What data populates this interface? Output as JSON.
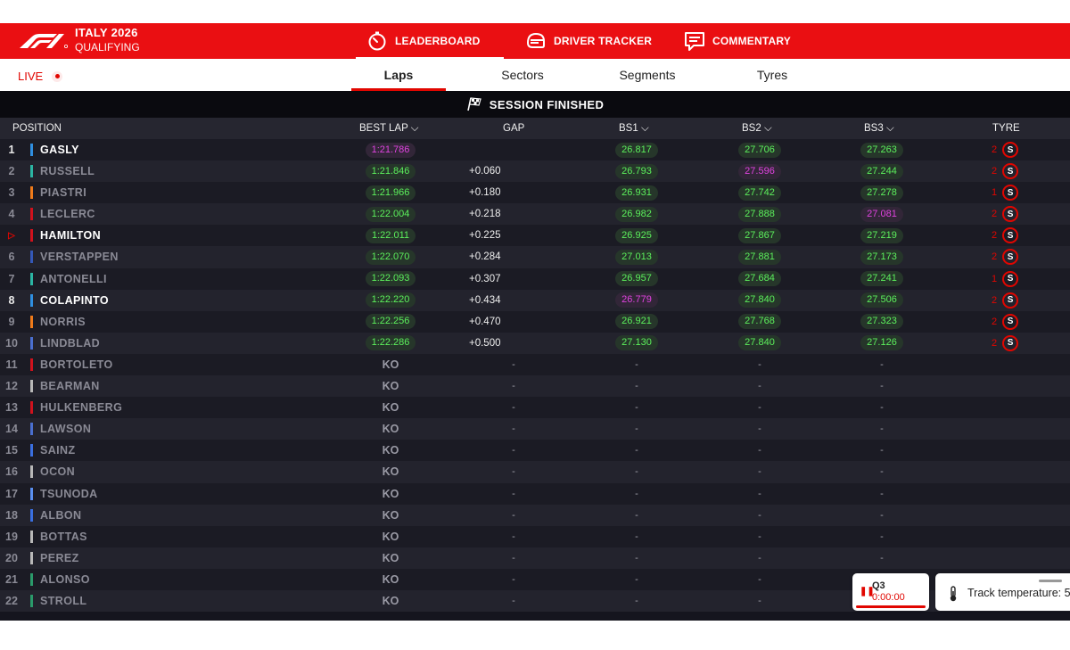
{
  "event": {
    "title": "ITALY 2026",
    "session": "QUALIFYING"
  },
  "nav": {
    "leaderboard": "LEADERBOARD",
    "driver_tracker": "DRIVER TRACKER",
    "commentary": "COMMENTARY"
  },
  "live": {
    "label": "LIVE"
  },
  "tabs": {
    "laps": "Laps",
    "sectors": "Sectors",
    "segments": "Segments",
    "tyres": "Tyres"
  },
  "status": {
    "session": "SESSION FINISHED"
  },
  "headers": {
    "position": "POSITION",
    "best_lap": "BEST LAP",
    "gap": "GAP",
    "bs1": "BS1",
    "bs2": "BS2",
    "bs3": "BS3",
    "tyre": "TYRE"
  },
  "colors": {
    "f1_red": "#ea0f12",
    "personal_best": "#5cf05c",
    "overall_best": "#e043e0"
  },
  "drivers": [
    {
      "pos": "1",
      "name": "GASLY",
      "team_color": "#2f8fe0",
      "highlight": true,
      "best_lap": "1:21.786",
      "best_lap_color": "purple",
      "gap": "",
      "bs1": "26.817",
      "bs1_color": "green",
      "bs2": "27.706",
      "bs2_color": "green",
      "bs3": "27.263",
      "bs3_color": "green",
      "tyre_laps": "2",
      "tyre": "S"
    },
    {
      "pos": "2",
      "name": "RUSSELL",
      "team_color": "#2bb5a3",
      "highlight": false,
      "best_lap": "1:21.846",
      "best_lap_color": "green",
      "gap": "+0.060",
      "bs1": "26.793",
      "bs1_color": "green",
      "bs2": "27.596",
      "bs2_color": "purple",
      "bs3": "27.244",
      "bs3_color": "green",
      "tyre_laps": "2",
      "tyre": "S"
    },
    {
      "pos": "3",
      "name": "PIASTRI",
      "team_color": "#f07b1a",
      "highlight": false,
      "best_lap": "1:21.966",
      "best_lap_color": "green",
      "gap": "+0.180",
      "bs1": "26.931",
      "bs1_color": "green",
      "bs2": "27.742",
      "bs2_color": "green",
      "bs3": "27.278",
      "bs3_color": "green",
      "tyre_laps": "1",
      "tyre": "S"
    },
    {
      "pos": "4",
      "name": "LECLERC",
      "team_color": "#d0121d",
      "highlight": false,
      "best_lap": "1:22.004",
      "best_lap_color": "green",
      "gap": "+0.218",
      "bs1": "26.982",
      "bs1_color": "green",
      "bs2": "27.888",
      "bs2_color": "green",
      "bs3": "27.081",
      "bs3_color": "purple",
      "tyre_laps": "2",
      "tyre": "S"
    },
    {
      "pos": "▷",
      "name": "HAMILTON",
      "team_color": "#d0121d",
      "highlight": true,
      "best_lap": "1:22.011",
      "best_lap_color": "green",
      "gap": "+0.225",
      "bs1": "26.925",
      "bs1_color": "green",
      "bs2": "27.867",
      "bs2_color": "green",
      "bs3": "27.219",
      "bs3_color": "green",
      "tyre_laps": "2",
      "tyre": "S"
    },
    {
      "pos": "6",
      "name": "VERSTAPPEN",
      "team_color": "#3458b8",
      "highlight": false,
      "best_lap": "1:22.070",
      "best_lap_color": "green",
      "gap": "+0.284",
      "bs1": "27.013",
      "bs1_color": "green",
      "bs2": "27.881",
      "bs2_color": "green",
      "bs3": "27.173",
      "bs3_color": "green",
      "tyre_laps": "2",
      "tyre": "S"
    },
    {
      "pos": "7",
      "name": "ANTONELLI",
      "team_color": "#2bb5a3",
      "highlight": false,
      "best_lap": "1:22.093",
      "best_lap_color": "green",
      "gap": "+0.307",
      "bs1": "26.957",
      "bs1_color": "green",
      "bs2": "27.684",
      "bs2_color": "green",
      "bs3": "27.241",
      "bs3_color": "green",
      "tyre_laps": "1",
      "tyre": "S"
    },
    {
      "pos": "8",
      "name": "COLAPINTO",
      "team_color": "#2f8fe0",
      "highlight": true,
      "best_lap": "1:22.220",
      "best_lap_color": "green",
      "gap": "+0.434",
      "bs1": "26.779",
      "bs1_color": "purple",
      "bs2": "27.840",
      "bs2_color": "green",
      "bs3": "27.506",
      "bs3_color": "green",
      "tyre_laps": "2",
      "tyre": "S"
    },
    {
      "pos": "9",
      "name": "NORRIS",
      "team_color": "#f07b1a",
      "highlight": false,
      "best_lap": "1:22.256",
      "best_lap_color": "green",
      "gap": "+0.470",
      "bs1": "26.921",
      "bs1_color": "green",
      "bs2": "27.768",
      "bs2_color": "green",
      "bs3": "27.323",
      "bs3_color": "green",
      "tyre_laps": "2",
      "tyre": "S"
    },
    {
      "pos": "10",
      "name": "LINDBLAD",
      "team_color": "#4a6fd0",
      "highlight": false,
      "best_lap": "1:22.286",
      "best_lap_color": "green",
      "gap": "+0.500",
      "bs1": "27.130",
      "bs1_color": "green",
      "bs2": "27.840",
      "bs2_color": "green",
      "bs3": "27.126",
      "bs3_color": "green",
      "tyre_laps": "2",
      "tyre": "S"
    },
    {
      "pos": "11",
      "name": "BORTOLETO",
      "team_color": "#d0121d",
      "ko": "KO",
      "dash": "-"
    },
    {
      "pos": "12",
      "name": "BEARMAN",
      "team_color": "#b8b8b8",
      "ko": "KO",
      "dash": "-"
    },
    {
      "pos": "13",
      "name": "HULKENBERG",
      "team_color": "#d0121d",
      "ko": "KO",
      "dash": "-"
    },
    {
      "pos": "14",
      "name": "LAWSON",
      "team_color": "#4a6fd0",
      "ko": "KO",
      "dash": "-"
    },
    {
      "pos": "15",
      "name": "SAINZ",
      "team_color": "#3a6fe0",
      "ko": "KO",
      "dash": "-"
    },
    {
      "pos": "16",
      "name": "OCON",
      "team_color": "#b8b8b8",
      "ko": "KO",
      "dash": "-"
    },
    {
      "pos": "17",
      "name": "TSUNODA",
      "team_color": "#5a8ff0",
      "ko": "KO",
      "dash": "-"
    },
    {
      "pos": "18",
      "name": "ALBON",
      "team_color": "#3a6fe0",
      "ko": "KO",
      "dash": "-"
    },
    {
      "pos": "19",
      "name": "BOTTAS",
      "team_color": "#b8b8b8",
      "ko": "KO",
      "dash": "-"
    },
    {
      "pos": "20",
      "name": "PEREZ",
      "team_color": "#b8b8b8",
      "ko": "KO",
      "dash": "-"
    },
    {
      "pos": "21",
      "name": "ALONSO",
      "team_color": "#2a9a6a",
      "ko": "KO",
      "dash": "-"
    },
    {
      "pos": "22",
      "name": "STROLL",
      "team_color": "#2a9a6a",
      "ko": "KO",
      "dash": "-"
    }
  ],
  "session_card": {
    "label": "Q3",
    "time": "0:00:00"
  },
  "track": {
    "label": "Track temperature: 5"
  }
}
